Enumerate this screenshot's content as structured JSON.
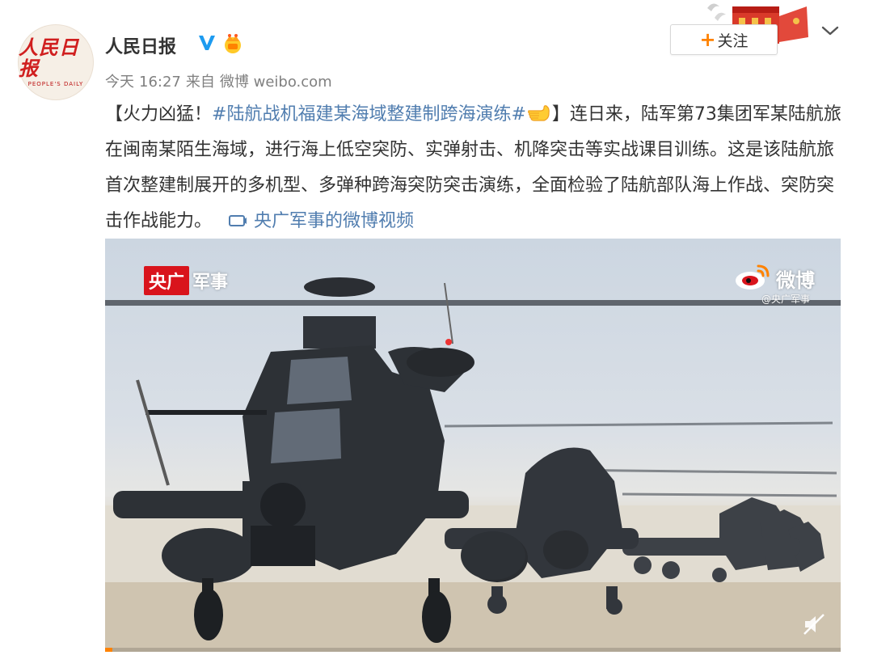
{
  "author": {
    "name": "人民日报",
    "avatar_text_cn": "人民日报",
    "avatar_text_en": "PEOPLE'S DAILY",
    "verified_icon": "verified-v-icon",
    "badge_icon": "crown-badge-icon"
  },
  "meta": {
    "day": "今天",
    "time": "16:27",
    "source_prefix": "来自",
    "source": "微博 weibo.com"
  },
  "actions": {
    "follow_plus": "+",
    "follow_label": "关注",
    "more_icon": "chevron-down-icon"
  },
  "post": {
    "open_bracket": "【",
    "title": "火力凶猛！",
    "hashtag": "#陆航战机福建某海域整建制跨海演练#",
    "close_bracket": "】",
    "body": "连日来，陆军第73集团军某陆航旅在闽南某陌生海域，进行海上低空突防、实弹射击、机降突击等实战课目训练。这是该陆航旅首次整建制展开的多机型、多弹种跨海突防突击演练，全面检验了陆航部队海上作战、突防突击作战能力。",
    "video_link": "央广军事的微博视频"
  },
  "video": {
    "watermark_red": "央广",
    "watermark_white": "军事",
    "weibo_label": "微博",
    "weibo_sub": "@央广军事",
    "progress": 0.01
  },
  "colors": {
    "link": "#507daf",
    "follow_plus": "#ff8200",
    "watermark_red": "#d9141c"
  }
}
